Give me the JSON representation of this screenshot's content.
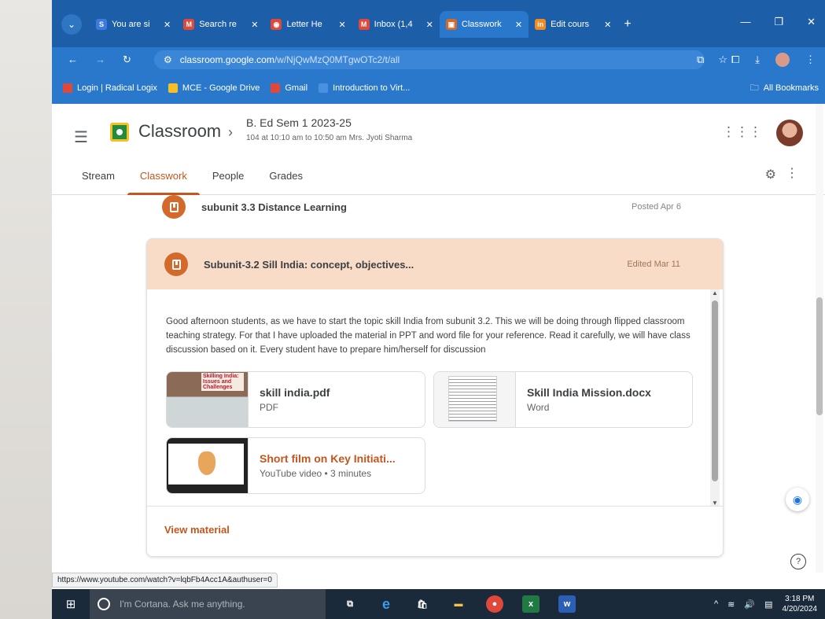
{
  "browser": {
    "tabs": [
      {
        "title": "You are si",
        "favicon_color": "#3b7be0",
        "favicon_letter": "S"
      },
      {
        "title": "Search re",
        "favicon_color": "#e0483b",
        "favicon_letter": "M"
      },
      {
        "title": "Letter He",
        "favicon_color": "#e0483b",
        "favicon_letter": "◉"
      },
      {
        "title": "Inbox (1,4",
        "favicon_color": "#e0483b",
        "favicon_letter": "M"
      },
      {
        "title": "Classwork",
        "favicon_color": "#f6bf26",
        "favicon_letter": "▣"
      },
      {
        "title": "Edit cours",
        "favicon_color": "#f08a24",
        "favicon_letter": "in"
      }
    ],
    "url_host": "classroom.google.com",
    "url_path": "/w/NjQwMzQ0MTgwOTc2/t/all",
    "bookmarks": [
      {
        "label": "Login | Radical Logix",
        "color": "#e0483b"
      },
      {
        "label": "MCE - Google Drive",
        "color": "#f6bf26"
      },
      {
        "label": "Gmail",
        "color": "#e0483b"
      },
      {
        "label": "Introduction to Virt...",
        "color": "#4a90e2"
      }
    ],
    "all_bookmarks": "All Bookmarks",
    "status_url": "https://www.youtube.com/watch?v=lqbFb4Acc1A&authuser=0"
  },
  "classroom": {
    "app_title": "Classroom",
    "course_title": "B. Ed Sem 1 2023-25",
    "course_subtitle": "104 at 10:10 am to 10:50 am Mrs. Jyoti Sharma",
    "tabs": [
      "Stream",
      "Classwork",
      "People",
      "Grades"
    ],
    "active_tab": "Classwork",
    "brand_color": "#c5551c"
  },
  "previous_item": {
    "title": "subunit 3.3 Distance Learning",
    "date": "Posted Apr 6"
  },
  "material": {
    "title": "Subunit-3.2 Sill India: concept, objectives...",
    "date": "Edited Mar 11",
    "description": "Good afternoon students, as we have to start the topic skill India from subunit 3.2. This we will be doing through flipped classroom teaching strategy. For that I have uploaded the material in PPT and word file for your reference. Read it carefully, we will have class discussion based on it. Every student have to prepare him/herself for discussion",
    "attachments": [
      {
        "name": "skill india.pdf",
        "type": "PDF",
        "thumb_text": "Skilling India: Issues and Challenges"
      },
      {
        "name": "Skill India Mission.docx",
        "type": "Word"
      },
      {
        "name": "Short film on Key Initiati...",
        "type": "YouTube video • 3 minutes"
      }
    ],
    "view_label": "View material"
  },
  "taskbar": {
    "cortana_placeholder": "I'm Cortana. Ask me anything.",
    "time": "3:18 PM",
    "date": "4/20/2024"
  }
}
